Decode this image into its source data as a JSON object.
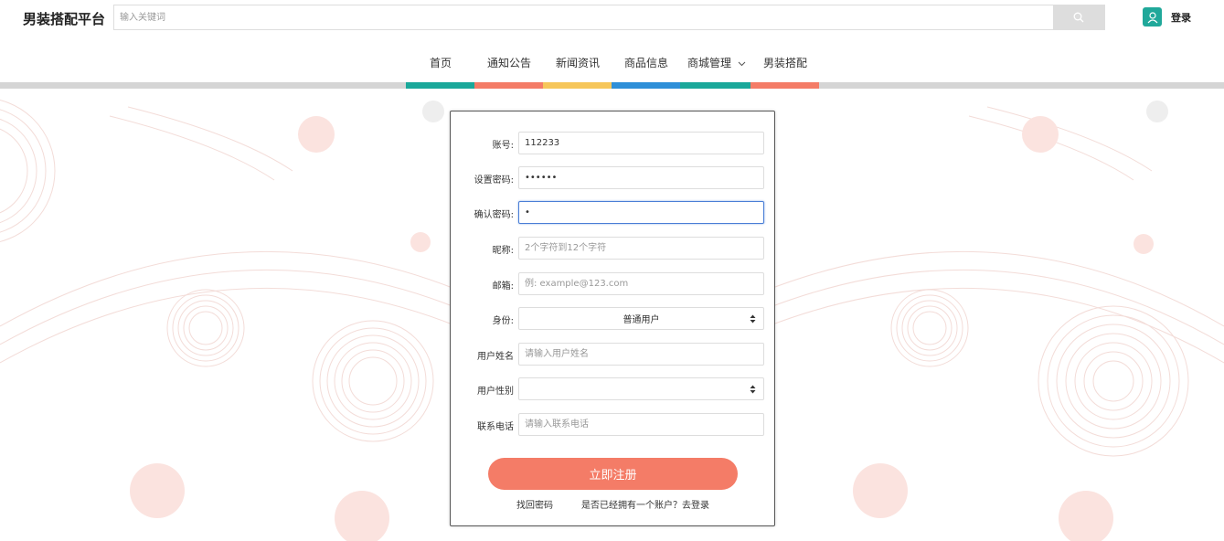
{
  "header": {
    "logo": "男装搭配平台",
    "search_placeholder": "输入关键词",
    "login_label": "登录"
  },
  "icons": {
    "search": "search-icon",
    "user": "user-icon",
    "select_arrow": "select-arrows-icon",
    "dropdown": "chevron-down-icon"
  },
  "nav": {
    "items": [
      "首页",
      "通知公告",
      "新闻资讯",
      "商品信息",
      "商城管理",
      "男装搭配"
    ],
    "colors": [
      "#1aa89a",
      "#f47c67",
      "#f6c65a",
      "#2e8fd8",
      "#1aa89a",
      "#f47c67"
    ]
  },
  "form": {
    "account": {
      "label": "账号:",
      "value": "112233"
    },
    "password": {
      "label": "设置密码:",
      "value": "••••••"
    },
    "confirm": {
      "label": "确认密码:",
      "value": "•"
    },
    "nickname": {
      "label": "昵称:",
      "placeholder": "2个字符到12个字符"
    },
    "email": {
      "label": "邮箱:",
      "placeholder": "例: example@123.com"
    },
    "role": {
      "label": "身份:",
      "selected": "普通用户"
    },
    "realname": {
      "label": "用户姓名",
      "placeholder": "请输入用户姓名"
    },
    "gender": {
      "label": "用户性别",
      "selected": ""
    },
    "phone": {
      "label": "联系电话",
      "placeholder": "请输入联系电话"
    },
    "submit_label": "立即注册",
    "forgot_label": "找回密码",
    "have_account_label": "是否已经拥有一个账户？去登录"
  },
  "colors": {
    "accent": "#f47c67",
    "teal": "#1aa89a",
    "focus": "#4a7ed6"
  }
}
